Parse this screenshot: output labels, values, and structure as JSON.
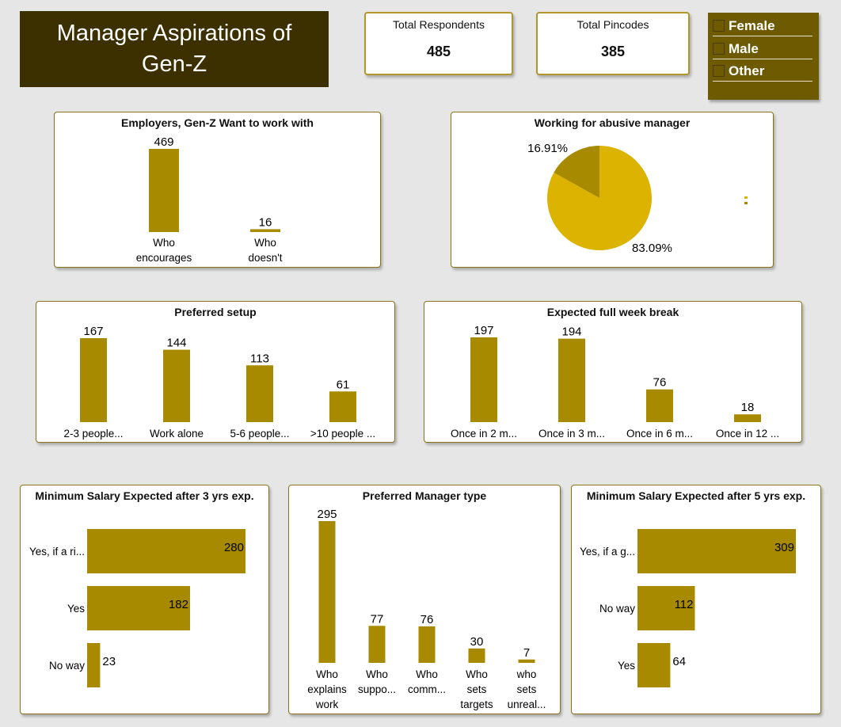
{
  "header": {
    "title_line1": "Manager Aspirations of",
    "title_line2": "Gen-Z"
  },
  "kpis": [
    {
      "label": "Total Respondents",
      "value": "485"
    },
    {
      "label": "Total Pincodes",
      "value": "385"
    }
  ],
  "slicer": {
    "items": [
      "Female",
      "Male",
      "Other"
    ]
  },
  "colors": {
    "bar": "#a78a00",
    "pie_major": "#dbb300",
    "pie_minor": "#a78a00",
    "title_bg": "#3d3000",
    "slicer_bg": "#6e5a00"
  },
  "chart_data": [
    {
      "id": "employers",
      "type": "bar",
      "title": "Employers, Gen-Z Want to work with",
      "categories": [
        "Who encourages",
        "Who doesn't support"
      ],
      "values": [
        469,
        16
      ]
    },
    {
      "id": "abusive",
      "type": "pie",
      "title": "Working for abusive manager",
      "slices": [
        {
          "label": "83.09%",
          "value": 83.09
        },
        {
          "label": "16.91%",
          "value": 16.91
        }
      ]
    },
    {
      "id": "setup",
      "type": "bar",
      "title": "Preferred setup",
      "categories": [
        "2-3 people...",
        "Work alone",
        "5-6 people...",
        ">10 people ..."
      ],
      "values": [
        167,
        144,
        113,
        61
      ]
    },
    {
      "id": "break",
      "type": "bar",
      "title": "Expected full week break",
      "categories": [
        "Once in 2 m...",
        "Once in 3 m...",
        "Once in 6 m...",
        "Once in 12 ..."
      ],
      "values": [
        197,
        194,
        76,
        18
      ]
    },
    {
      "id": "salary3",
      "type": "bar",
      "orientation": "horizontal",
      "title": "Minimum Salary Expected after 3 yrs exp.",
      "categories": [
        "Yes, if a ri...",
        "Yes",
        "No way"
      ],
      "values": [
        280,
        182,
        23
      ]
    },
    {
      "id": "mgrtype",
      "type": "bar",
      "title": "Preferred Manager type",
      "categories": [
        "Who explains work",
        "Who suppo...",
        "Who comm...",
        "Who sets targets",
        "who sets unreal..."
      ],
      "values": [
        295,
        77,
        76,
        30,
        7
      ]
    },
    {
      "id": "salary5",
      "type": "bar",
      "orientation": "horizontal",
      "title": "Minimum Salary Expected after 5 yrs exp.",
      "categories": [
        "Yes, if a g...",
        "No way",
        "Yes"
      ],
      "values": [
        309,
        112,
        64
      ]
    }
  ]
}
